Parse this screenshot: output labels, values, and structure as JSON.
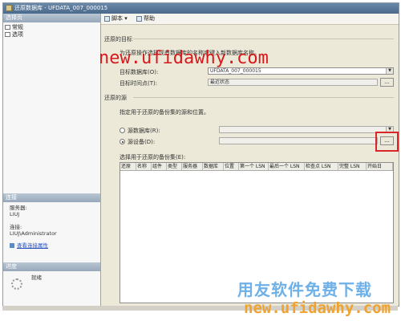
{
  "window": {
    "title": "还原数据库 - UFDATA_007_000015"
  },
  "left_panel": {
    "select_page_header": "选择页",
    "pages": [
      {
        "label": "常规"
      },
      {
        "label": "选项"
      }
    ],
    "connection_header": "连接",
    "server_label": "服务器:",
    "server_value": "LIUJ",
    "connection_label": "连接:",
    "connection_value": "LIUJ\\Administrator",
    "view_properties_link": "查看连接属性",
    "progress_header": "进度",
    "progress_status": "就绪"
  },
  "toolbar": {
    "script_label": "脚本",
    "help_label": "帮助"
  },
  "target": {
    "section_label": "还原的目标",
    "description": "为还原操作选择现有数据库的名称或键入新数据库名称。",
    "target_db_label": "目标数据库(O):",
    "target_db_value": "UFDATA_007_000015",
    "target_time_label": "目标时间点(T):",
    "target_time_value": "最近状态",
    "browse_label": "..."
  },
  "source": {
    "section_label": "还原的源",
    "description": "指定用于还原的备份集的源和位置。",
    "from_db_label": "源数据库(R):",
    "from_device_label": "源设备(D):",
    "from_device_selected": true,
    "browse_label": "..."
  },
  "backup_sets": {
    "label": "选择用于还原的备份集(E):",
    "columns": [
      "还原",
      "名称",
      "组件",
      "类型",
      "服务器",
      "数据库",
      "位置",
      "第一个 LSN",
      "最后一个 LSN",
      "检查点 LSN",
      "完整 LSN",
      "开始日"
    ],
    "rows": []
  },
  "watermark": {
    "top": "new.ufidawhy.com",
    "cn": "用友软件免费下载",
    "bottom": "new.ufidawhy.com"
  },
  "colors": {
    "highlight_box": "#d9262a",
    "watermark_red": "#d7191c",
    "watermark_blue": "#6eb0e8",
    "watermark_orange": "#f0a22e"
  }
}
